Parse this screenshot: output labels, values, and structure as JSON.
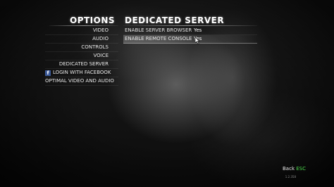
{
  "header": {
    "options_title": "OPTIONS",
    "panel_title": "DEDICATED SERVER"
  },
  "menu": {
    "items": [
      {
        "label": "VIDEO"
      },
      {
        "label": "AUDIO"
      },
      {
        "label": "CONTROLS"
      },
      {
        "label": "VOICE"
      },
      {
        "label": "DEDICATED SERVER"
      },
      {
        "label": "LOGIN WITH FACEBOOK",
        "icon": "facebook-icon"
      },
      {
        "label": "OPTIMAL VIDEO AND AUDIO"
      }
    ]
  },
  "settings": {
    "rows": [
      {
        "label": "ENABLE SERVER BROWSER",
        "value": "Yes"
      },
      {
        "label": "ENABLE REMOTE CONSOLE",
        "value": "Yes"
      }
    ]
  },
  "footer": {
    "back_label": "Back",
    "back_key": "ESC",
    "version": "1.2.358"
  },
  "colors": {
    "accent_key": "#4cd84c",
    "facebook": "#3b5998"
  }
}
